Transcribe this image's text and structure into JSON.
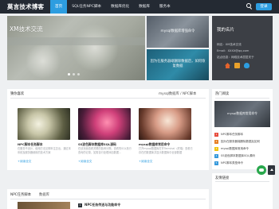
{
  "site": {
    "logo": "莫言技术博客"
  },
  "nav": {
    "items": [
      {
        "label": "首页",
        "active": true
      },
      {
        "label": "SQL任务NPC脚本",
        "active": false
      },
      {
        "label": "数据库优化",
        "active": false
      },
      {
        "label": "数据库",
        "active": false
      },
      {
        "label": "服务本",
        "active": false
      }
    ],
    "login_label": "登录"
  },
  "hero": {
    "slider_title": "XM技术交流",
    "promo1": "mysql数据库增强命令",
    "promo2": "因为在服务器端删除数据后，如何恢复数据"
  },
  "profile": {
    "title": "我的名片",
    "name_line": "网名：XM技术交流",
    "email_line": "Email：XXXX@qq.com",
    "site_line": "站点信息：网络技术层层关于"
  },
  "recommend": {
    "heading": "猜你喜欢",
    "breadcrumb": "mysql数据库 / NPC脚本",
    "articles": [
      {
        "title": "NPC脚本任务脚本",
        "desc": "在服务不设计，使用方法见脚本注意出，通过本系统及服务器使用的技术方案",
        "more": "+阅读全文"
      },
      {
        "title": "SS波色脚本数据库SQL源码",
        "desc": "在该页面查看关联的各种分隔，查看的SQL执行查询的记录，如需自行处理添加数据...",
        "more": "+阅读全文"
      },
      {
        "title": "mysql数据库常用命令",
        "desc": "打开mysql数据库打开Terminal（终端）查看已存在的数据库并显示数据库中全部数据",
        "more": "+阅读全文"
      }
    ]
  },
  "hot": {
    "heading": "热门阅读",
    "thumb_caption": "mysql数据库常用命令",
    "items": [
      {
        "num": "1",
        "label": "NPC脚本任务脚本"
      },
      {
        "num": "2",
        "label": "因为在服务器端删除数据后如何"
      },
      {
        "num": "3",
        "label": "mysql数据库常用命令"
      },
      {
        "num": "4",
        "label": "SS波色脚本数据库SQL源码"
      },
      {
        "num": "5",
        "label": "NPC脚本类型命令"
      }
    ]
  },
  "npc_section": {
    "heading": "NPC任务脚本",
    "sub": "数据库",
    "article_num": "1",
    "article_title": "NPC任务传送与功能命令"
  },
  "friends": {
    "heading": "友情链接"
  },
  "colors": {
    "accent": "#2d9de0",
    "topbar": "#242a33",
    "profile_bg": "#3c3f45"
  }
}
